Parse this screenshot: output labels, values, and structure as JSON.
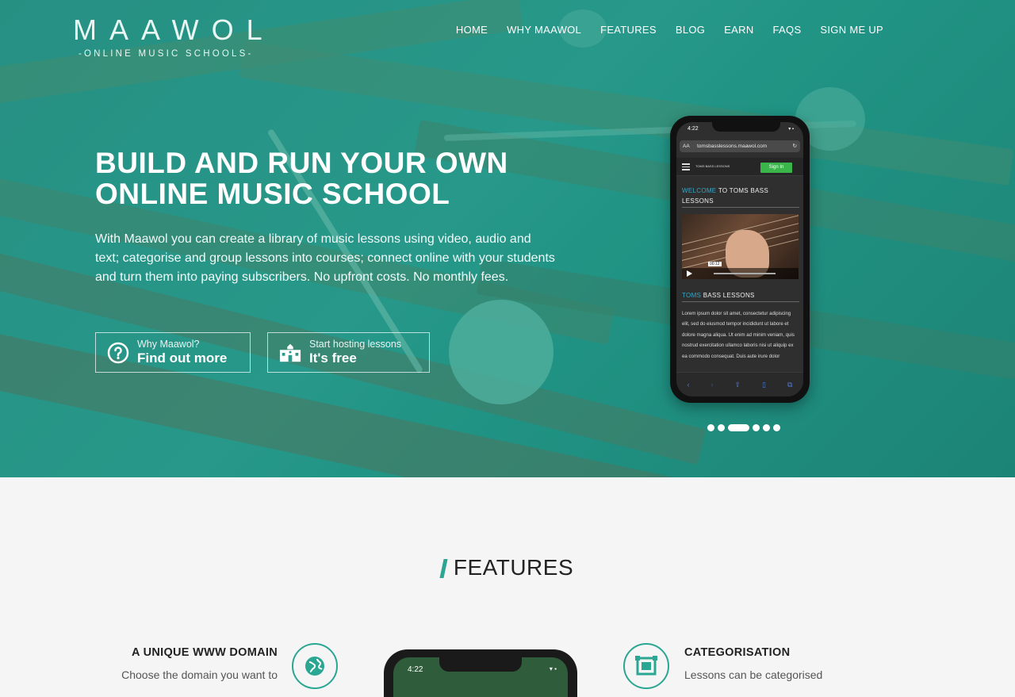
{
  "header": {
    "logo_word": "MAAWOL",
    "logo_sub": "-ONLINE MUSIC SCHOOLS-",
    "nav": [
      "HOME",
      "WHY MAAWOL",
      "FEATURES",
      "BLOG",
      "EARN",
      "FAQS",
      "SIGN ME UP"
    ]
  },
  "hero": {
    "headline_line1": "BUILD AND RUN YOUR OWN",
    "headline_line2": "ONLINE MUSIC SCHOOL",
    "lead": "With Maawol you can create a library of music lessons using video, audio and text; categorise and group lessons into courses; connect online with your students and turn them into paying subscribers. No upfront costs. No monthly fees.",
    "cta_why": {
      "small": "Why Maawol?",
      "big": "Find out more",
      "icon": "question-circle-icon"
    },
    "cta_start": {
      "small": "Start hosting lessons",
      "big": "It's free",
      "icon": "school-building-icon"
    },
    "carousel": {
      "count": 6,
      "active_index": 2
    }
  },
  "phone": {
    "time": "4:22",
    "status": "▾ ▪",
    "aa": "AA",
    "url": "tomsbasslessons.maawol.com",
    "logo_text": "TOMS BASS LESSONS",
    "signin": "Sign In",
    "welcome_accent": "WELCOME",
    "welcome_rest": "TO TOMS BASS LESSONS",
    "video_time": "00:12",
    "toms_accent": "TOMS",
    "toms_rest": "BASS LESSONS",
    "body": "Lorem ipsum dolor sit amet, consectetur adipiscing elit, sed do eiusmod tempor incididunt ut labore et dolore magna aliqua. Ut enim ad minim veniam, quis nostrud exercitation ullamco laboris nisi ut aliquip ex ea commodo consequat. Duis aute irure dolor"
  },
  "features": {
    "title": "FEATURES",
    "left_title": "A UNIQUE WWW DOMAIN",
    "left_text": "Choose the domain you want to",
    "right_title": "CATEGORISATION",
    "right_text": "Lessons can be categorised",
    "phone_time": "4:22"
  },
  "colors": {
    "accent": "#2aa693",
    "hero": "#2b9a8c",
    "link_blue": "#34a7c8",
    "signin_green": "#39b54a"
  }
}
